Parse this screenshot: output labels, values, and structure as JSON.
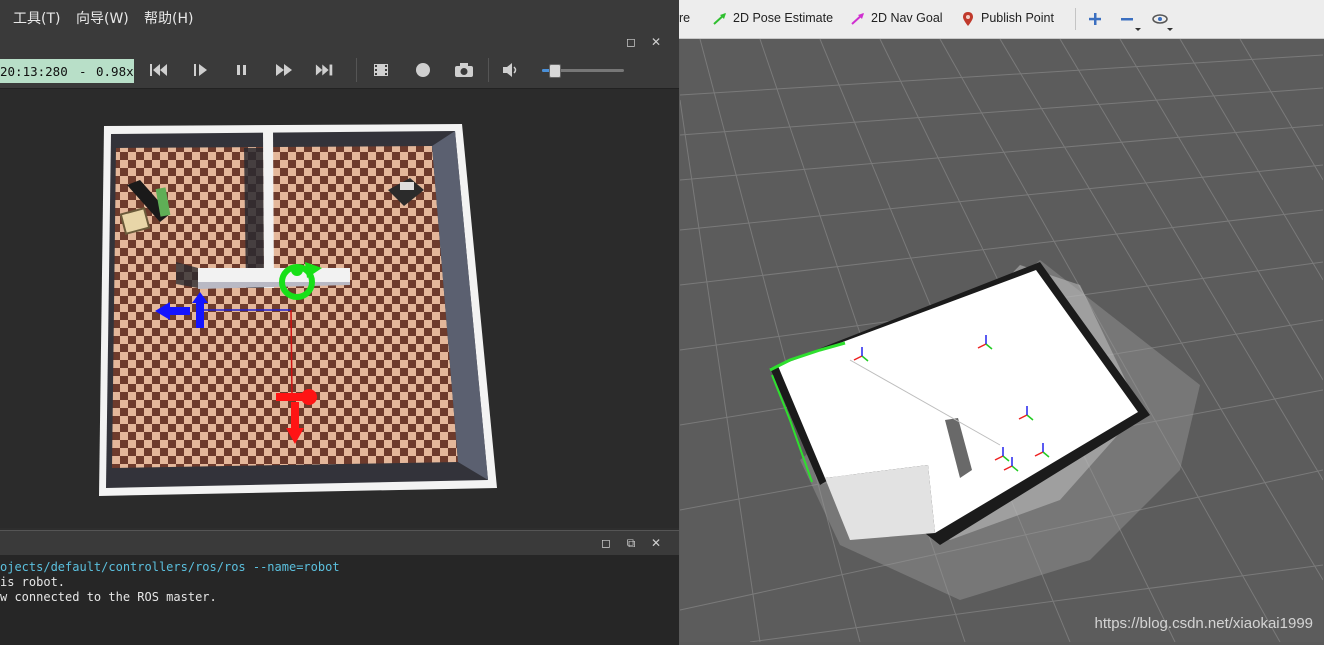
{
  "webots": {
    "menu": [
      {
        "label": "工具(T)"
      },
      {
        "label": "向导(W)"
      },
      {
        "label": "帮助(H)"
      }
    ],
    "toolbar": {
      "time": "20:13:280",
      "separator": "-",
      "speed": "0.98x",
      "volume_level": 0.15
    },
    "console": {
      "lines": [
        "ojects/default/controllers/ros/ros --name=robot",
        "is robot.",
        "w connected to the ROS master."
      ],
      "link_color": "#5bc0de"
    }
  },
  "rviz": {
    "tools": [
      {
        "label": "re",
        "icon": "interact-icon"
      },
      {
        "label": "2D Pose Estimate",
        "icon": "pose-estimate-arrow-icon",
        "color": "#2fbf2f"
      },
      {
        "label": "2D Nav Goal",
        "icon": "nav-goal-arrow-icon",
        "color": "#d02fd0"
      },
      {
        "label": "Publish Point",
        "icon": "map-pin-icon",
        "color": "#c0392b"
      }
    ],
    "watermark": "https://blog.csdn.net/xiaokai1999"
  }
}
